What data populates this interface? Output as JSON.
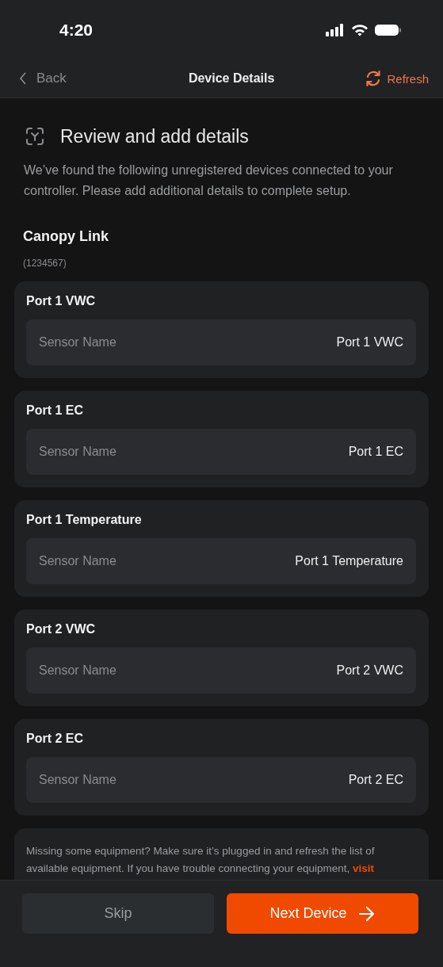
{
  "status_bar": {
    "time": "4:20"
  },
  "nav": {
    "back": "Back",
    "title": "Device Details",
    "refresh": "Refresh"
  },
  "intro": {
    "heading": "Review and add details",
    "description": "We’ve found the following unregistered devices connected to your controller. Please add additional details to complete setup."
  },
  "device": {
    "name": "Canopy Link",
    "serial": "(1234567)"
  },
  "sensors": [
    {
      "title": "Port 1 VWC",
      "label": "Sensor Name",
      "value": "Port 1 VWC"
    },
    {
      "title": "Port 1 EC",
      "label": "Sensor Name",
      "value": "Port 1 EC"
    },
    {
      "title": "Port 1 Temperature",
      "label": "Sensor Name",
      "value": "Port 1 Temperature"
    },
    {
      "title": "Port 2 VWC",
      "label": "Sensor Name",
      "value": "Port 2 VWC"
    },
    {
      "title": "Port 2 EC",
      "label": "Sensor Name",
      "value": "Port 2 EC"
    }
  ],
  "help": {
    "text": "Missing some equipment? Make sure it’s plugged in and refresh the list of available equipment. If you have trouble connecting your equipment,",
    "link": "visit"
  },
  "footer": {
    "skip": "Skip",
    "next": "Next Device"
  }
}
